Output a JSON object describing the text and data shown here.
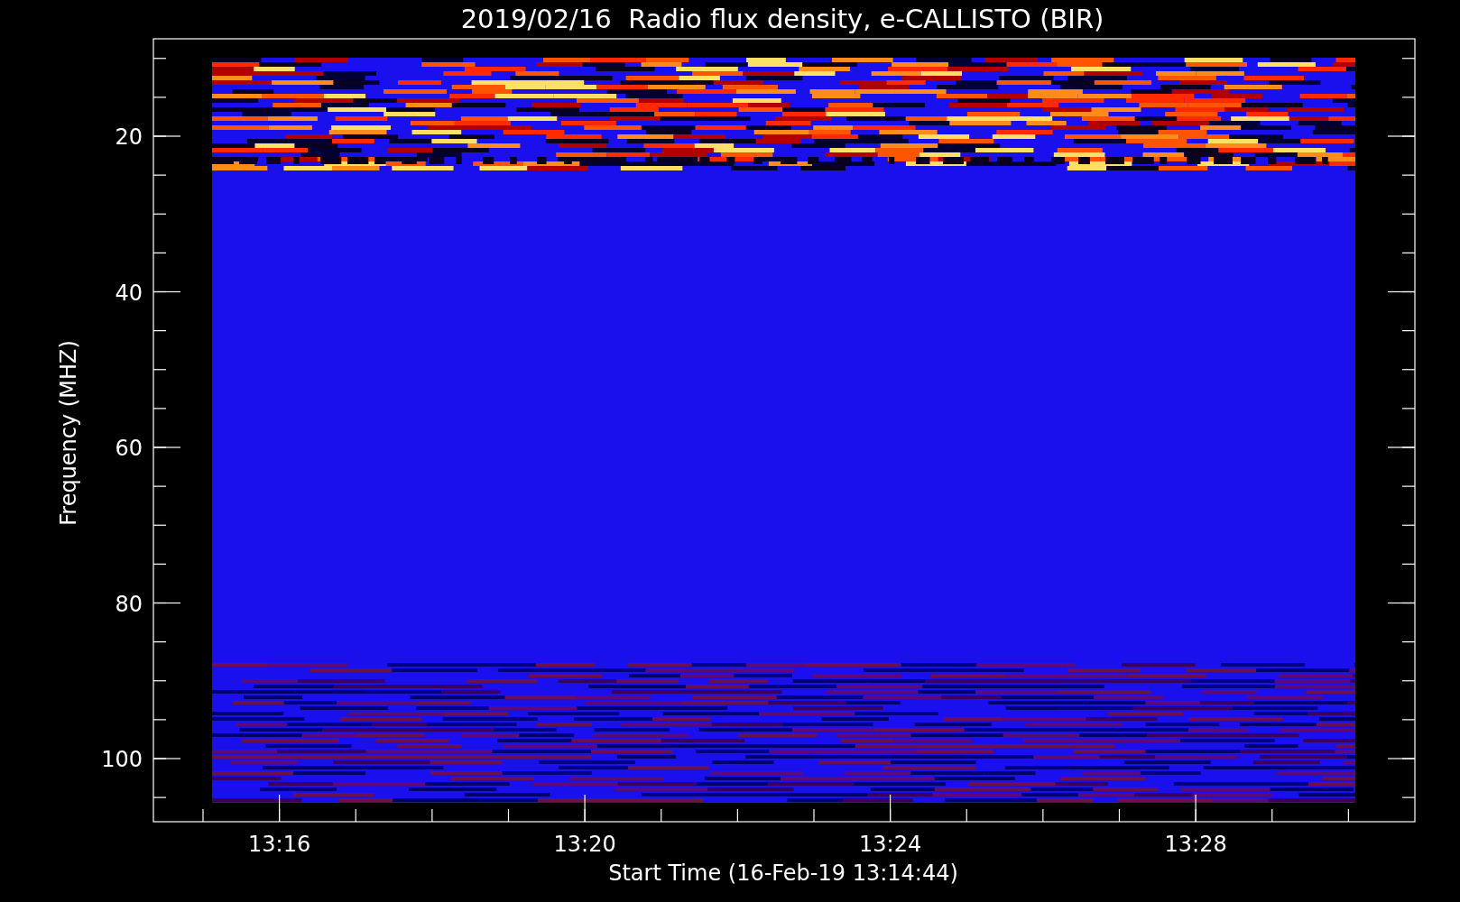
{
  "title": "2019/02/16  Radio flux density, e-CALLISTO (BIR)",
  "y_axis": {
    "label": "Frequency (MHZ)",
    "ticks": [
      "20",
      "40",
      "60",
      "80",
      "100"
    ]
  },
  "x_axis": {
    "label": "Start Time (16-Feb-19 13:14:44)",
    "ticks": [
      "13:16",
      "13:20",
      "13:24",
      "13:28"
    ]
  }
}
